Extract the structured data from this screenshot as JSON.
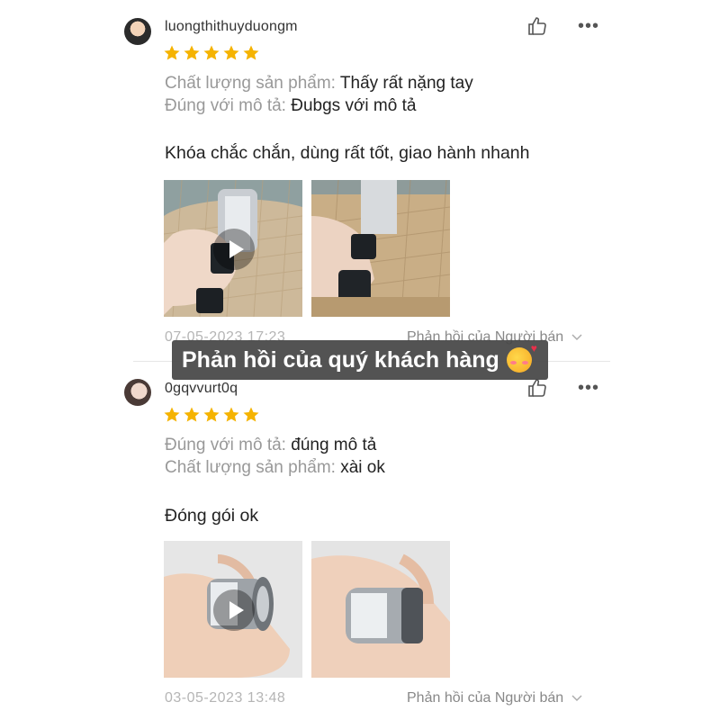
{
  "reviews": [
    {
      "username": "luongthithuyduongm",
      "rating": 5,
      "attributes": [
        {
          "key": "Chất lượng sản phẩm:",
          "value": "Thấy rất nặng tay"
        },
        {
          "key": "Đúng với mô tả:",
          "value": "Đubgs với mô tả"
        }
      ],
      "comment": "Khóa chắc chắn, dùng rất tốt, giao hành nhanh",
      "date": "07-05-2023 17:23",
      "seller_reply": "Phản hồi của Người bán"
    },
    {
      "username": "0gqvvurt0q",
      "rating": 5,
      "attributes": [
        {
          "key": "Đúng với mô tả:",
          "value": "đúng mô tả"
        },
        {
          "key": "Chất lượng sản phẩm:",
          "value": "xài ok"
        }
      ],
      "comment": "Đóng gói ok",
      "date": "03-05-2023 13:48",
      "seller_reply": "Phản hồi của Người bán"
    }
  ],
  "banner": {
    "text": "Phản hồi của quý khách hàng"
  },
  "icons": {
    "like": "thumbs-up-icon",
    "more": "more-icon",
    "star": "star-icon",
    "play": "play-icon",
    "chevron": "chevron-down-icon"
  },
  "colors": {
    "star": "#f5b301",
    "muted": "#999999"
  }
}
